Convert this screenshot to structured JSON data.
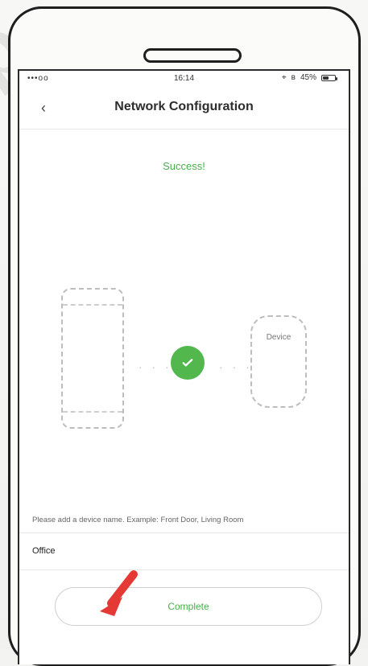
{
  "status_bar": {
    "signal": "•••oo",
    "time": "16:14",
    "battery": "45%"
  },
  "header": {
    "back_icon": "chevron-left-icon",
    "title": "Network Configuration"
  },
  "main": {
    "success_text": "Success!",
    "device_label": "Device",
    "hint": "Please add a device name. Example: Front Door, Living Room",
    "device_name_value": "Office",
    "complete_label": "Complete"
  },
  "colors": {
    "success_green": "#46b04a",
    "check_green": "#52b84e",
    "annotation_red": "#e53935"
  }
}
